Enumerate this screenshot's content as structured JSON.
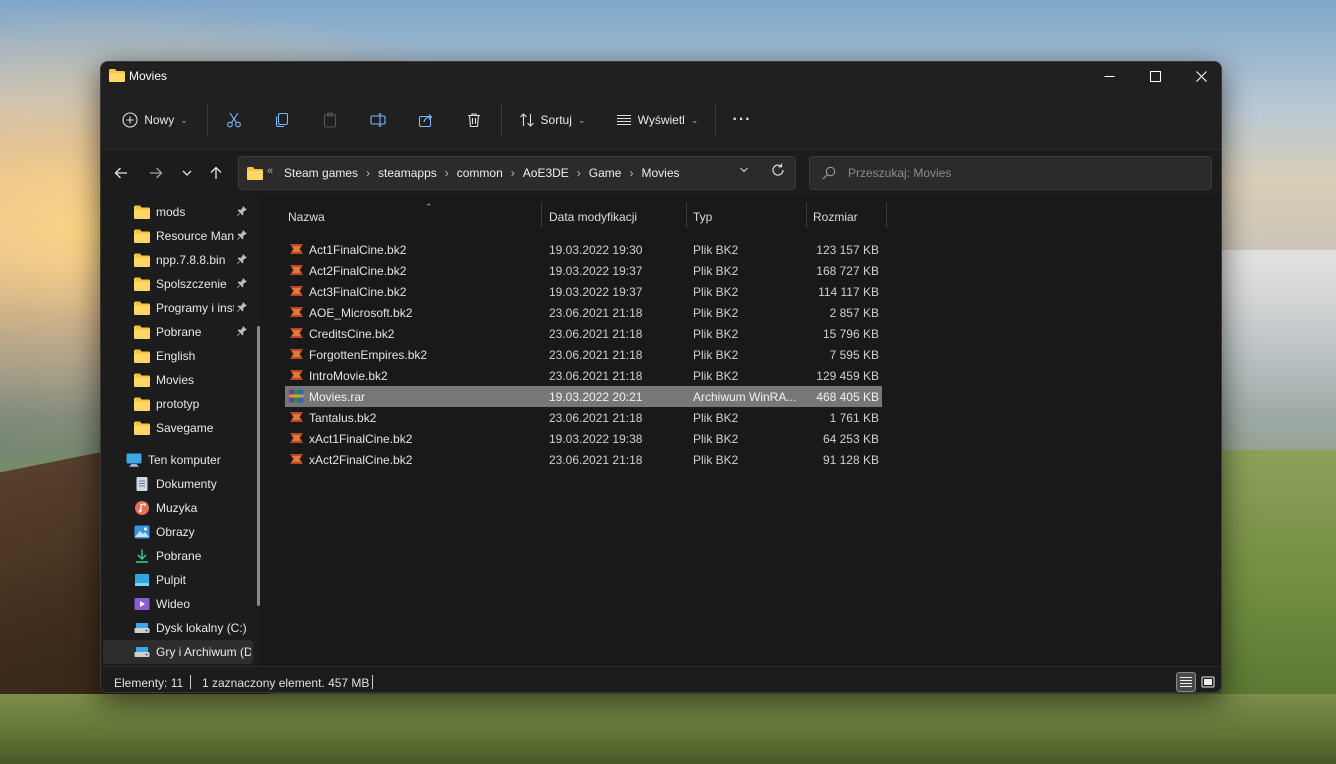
{
  "window": {
    "title": "Movies"
  },
  "toolbar": {
    "new_label": "Nowy",
    "sort_label": "Sortuj",
    "view_label": "Wyświetl",
    "more_label": "···"
  },
  "address": {
    "overflow": "«",
    "crumbs": [
      "Steam games",
      "steamapps",
      "common",
      "AoE3DE",
      "Game",
      "Movies"
    ],
    "separator": "›"
  },
  "search": {
    "placeholder": "Przeszukaj: Movies"
  },
  "sidebar": {
    "items": [
      {
        "label": "mods",
        "icon": "folder-icon",
        "pinned": true
      },
      {
        "label": "Resource Manager",
        "icon": "folder-icon",
        "pinned": true
      },
      {
        "label": "npp.7.8.8.bin",
        "icon": "folder-icon",
        "pinned": true
      },
      {
        "label": "Spolszczenie",
        "icon": "folder-icon",
        "pinned": true
      },
      {
        "label": "Programy i instalki",
        "icon": "folder-icon",
        "pinned": true
      },
      {
        "label": "Pobrane",
        "icon": "folder-icon",
        "pinned": true
      },
      {
        "label": "English",
        "icon": "folder-icon",
        "pinned": false
      },
      {
        "label": "Movies",
        "icon": "folder-icon",
        "pinned": false
      },
      {
        "label": "prototyp",
        "icon": "folder-icon",
        "pinned": false
      },
      {
        "label": "Savegame",
        "icon": "folder-icon",
        "pinned": false
      },
      {
        "label": "Ten komputer",
        "icon": "computer-icon",
        "pinned": false
      },
      {
        "label": "Dokumenty",
        "icon": "documents-icon",
        "pinned": false
      },
      {
        "label": "Muzyka",
        "icon": "music-icon",
        "pinned": false
      },
      {
        "label": "Obrazy",
        "icon": "pictures-icon",
        "pinned": false
      },
      {
        "label": "Pobrane",
        "icon": "download-icon",
        "pinned": false
      },
      {
        "label": "Pulpit",
        "icon": "desktop-icon",
        "pinned": false
      },
      {
        "label": "Wideo",
        "icon": "video-icon",
        "pinned": false
      },
      {
        "label": "Dysk lokalny (C:)",
        "icon": "drive-icon",
        "pinned": false
      },
      {
        "label": "Gry i Archiwum (D:)",
        "icon": "drive-icon",
        "pinned": false
      }
    ]
  },
  "columns": {
    "name": "Nazwa",
    "date": "Data modyfikacji",
    "type": "Typ",
    "size": "Rozmiar"
  },
  "files": [
    {
      "name": "Act1FinalCine.bk2",
      "date": "19.03.2022 19:30",
      "type": "Plik BK2",
      "size": "123 157 KB",
      "icon": "bk2-file-icon"
    },
    {
      "name": "Act2FinalCine.bk2",
      "date": "19.03.2022 19:37",
      "type": "Plik BK2",
      "size": "168 727 KB",
      "icon": "bk2-file-icon"
    },
    {
      "name": "Act3FinalCine.bk2",
      "date": "19.03.2022 19:37",
      "type": "Plik BK2",
      "size": "114 117 KB",
      "icon": "bk2-file-icon"
    },
    {
      "name": "AOE_Microsoft.bk2",
      "date": "23.06.2021 21:18",
      "type": "Plik BK2",
      "size": "2 857 KB",
      "icon": "bk2-file-icon"
    },
    {
      "name": "CreditsCine.bk2",
      "date": "23.06.2021 21:18",
      "type": "Plik BK2",
      "size": "15 796 KB",
      "icon": "bk2-file-icon"
    },
    {
      "name": "ForgottenEmpires.bk2",
      "date": "23.06.2021 21:18",
      "type": "Plik BK2",
      "size": "7 595 KB",
      "icon": "bk2-file-icon"
    },
    {
      "name": "IntroMovie.bk2",
      "date": "23.06.2021 21:18",
      "type": "Plik BK2",
      "size": "129 459 KB",
      "icon": "bk2-file-icon"
    },
    {
      "name": "Movies.rar",
      "date": "19.03.2022 20:21",
      "type": "Archiwum WinRA...",
      "size": "468 405 KB",
      "icon": "winrar-icon",
      "selected": true
    },
    {
      "name": "Tantalus.bk2",
      "date": "23.06.2021 21:18",
      "type": "Plik BK2",
      "size": "1 761 KB",
      "icon": "bk2-file-icon"
    },
    {
      "name": "xAct1FinalCine.bk2",
      "date": "19.03.2022 19:38",
      "type": "Plik BK2",
      "size": "64 253 KB",
      "icon": "bk2-file-icon"
    },
    {
      "name": "xAct2FinalCine.bk2",
      "date": "23.06.2021 21:18",
      "type": "Plik BK2",
      "size": "91 128 KB",
      "icon": "bk2-file-icon"
    }
  ],
  "status": {
    "count": "Elementy: 11",
    "selection": "1 zaznaczony element. 457 MB"
  },
  "colors": {
    "folder": "#f5c542",
    "window_bg": "#191919",
    "selected_row": "#777777"
  }
}
